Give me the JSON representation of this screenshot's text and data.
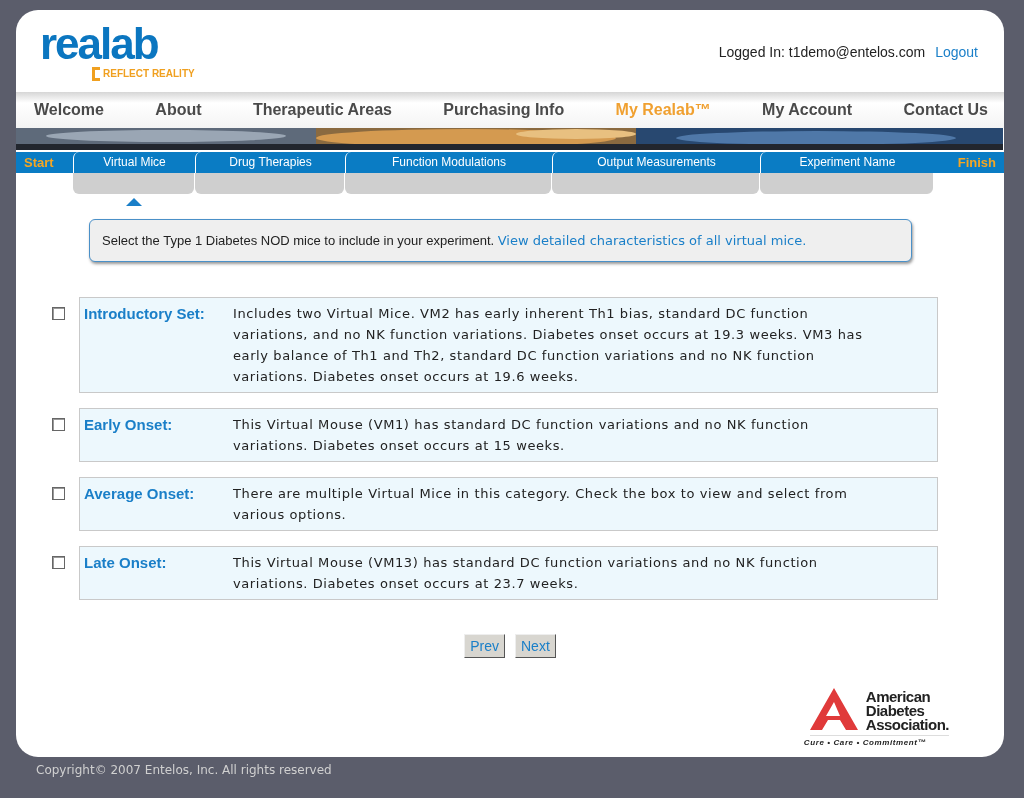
{
  "logo": {
    "name": "realab",
    "tagline": "REFLECT REALITY"
  },
  "user": {
    "label": "Logged In: t1demo@entelos.com",
    "logout": "Logout"
  },
  "nav": [
    {
      "label": "Welcome",
      "selected": false
    },
    {
      "label": "About",
      "selected": false
    },
    {
      "label": "Therapeutic Areas",
      "selected": false
    },
    {
      "label": "Purchasing Info",
      "selected": false
    },
    {
      "label": "My Realab™",
      "selected": true
    },
    {
      "label": "My Account",
      "selected": false
    },
    {
      "label": "Contact Us",
      "selected": false
    }
  ],
  "wizard": {
    "start": "Start",
    "finish": "Finish",
    "steps": [
      {
        "label": "Virtual Mice",
        "selected": true
      },
      {
        "label": "Drug Therapies",
        "selected": false
      },
      {
        "label": "Function Modulations",
        "selected": false
      },
      {
        "label": "Output Measurements",
        "selected": false
      },
      {
        "label": "Experiment Name",
        "selected": false
      }
    ]
  },
  "instruction": {
    "text": "Select the Type 1 Diabetes NOD mice to include in your experiment.",
    "link": "View detailed characteristics of all virtual mice."
  },
  "options": [
    {
      "checked": false,
      "label": "Introductory Set:",
      "description": "Includes two Virtual Mice. VM2 has early inherent Th1 bias, standard DC function variations, and no NK function variations. Diabetes onset occurs at 19.3 weeks. VM3 has early balance of Th1 and Th2, standard DC function variations and no NK function variations. Diabetes onset occurs at 19.6 weeks."
    },
    {
      "checked": false,
      "label": "Early Onset:",
      "description": "This Virtual Mouse (VM1) has standard DC function variations and no NK function variations. Diabetes onset occurs at 15 weeks."
    },
    {
      "checked": false,
      "label": "Average Onset:",
      "description": "There are multiple Virtual Mice in this category. Check the box to view and select from various options."
    },
    {
      "checked": false,
      "label": "Late Onset:",
      "description": "This Virtual Mouse (VM13) has standard DC function variations and no NK function variations. Diabetes onset occurs at 23.7 weeks."
    }
  ],
  "buttons": [
    "Prev",
    "Next"
  ],
  "sponsor": {
    "lines": [
      "American",
      "Diabetes",
      "Association."
    ],
    "slogan": "Cure • Care • Commitment™"
  },
  "copyright": "Copyright© 2007 Entelos, Inc. All rights reserved"
}
